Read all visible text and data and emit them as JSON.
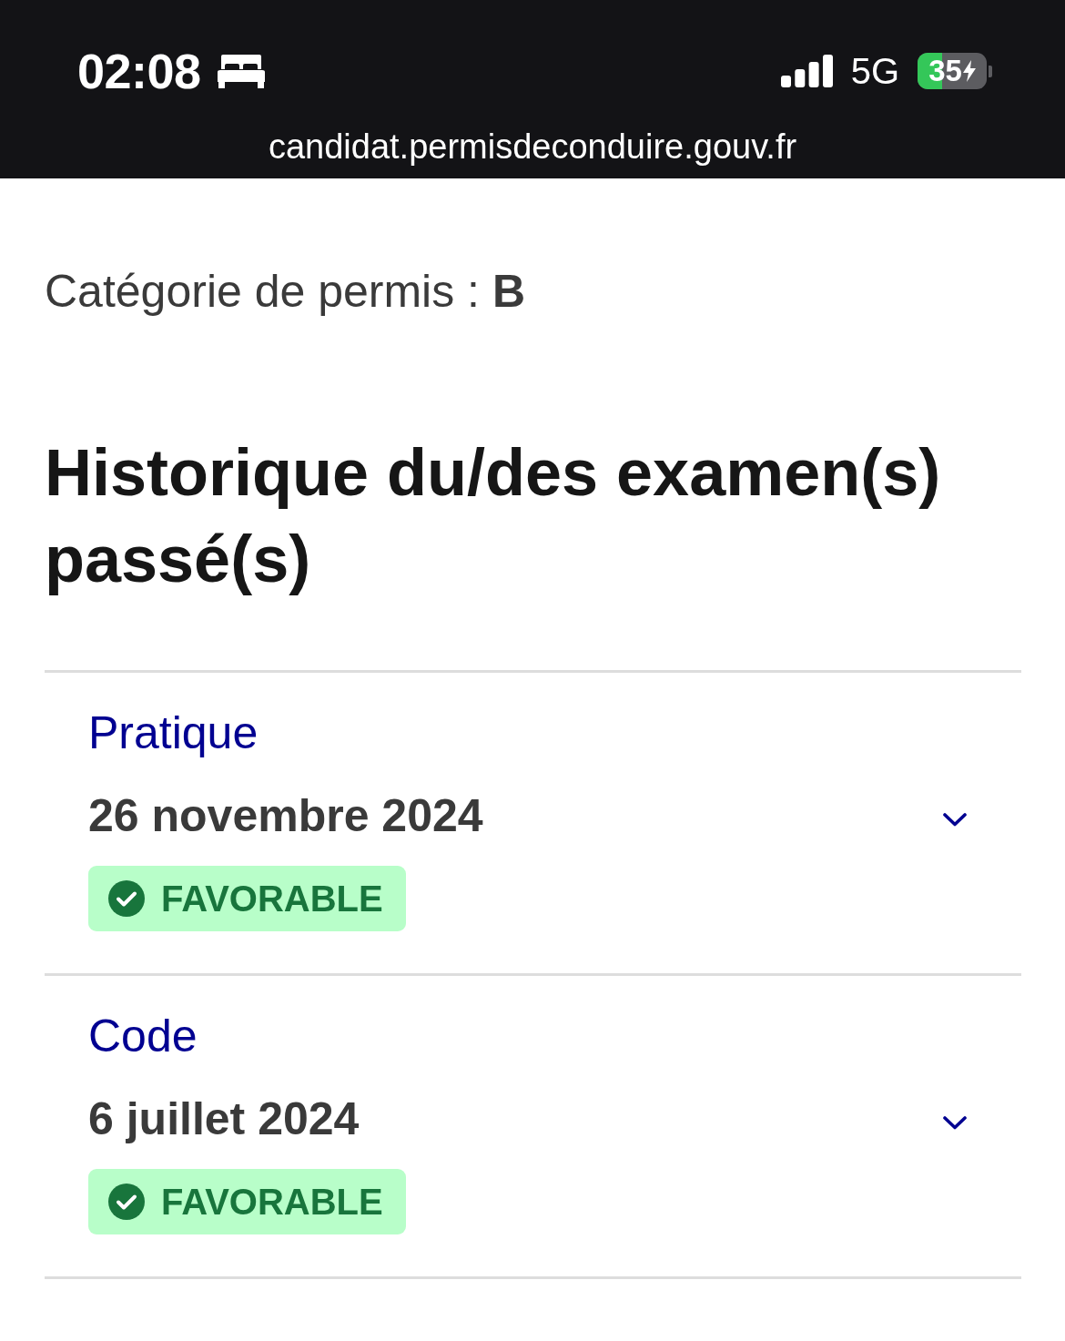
{
  "status_bar": {
    "time": "02:08",
    "network": "5G",
    "battery": "35",
    "charging": true
  },
  "address_bar": {
    "url": "candidat.permisdeconduire.gouv.fr"
  },
  "license_category": "Catégorie de permis : **B**",
  "heading": "Historique du/des examen(s) passé(s)",
  "exams": [
    {
      "type": "Pratique",
      "date": "26 novembre 2024",
      "expanded": false,
      "result": {
        "label": "FAVORABLE",
        "kind": "success"
      }
    },
    {
      "type": "Code",
      "date": "6 juillet 2024",
      "expanded": false,
      "result": {
        "label": "FAVORABLE",
        "kind": "success"
      }
    }
  ]
}
